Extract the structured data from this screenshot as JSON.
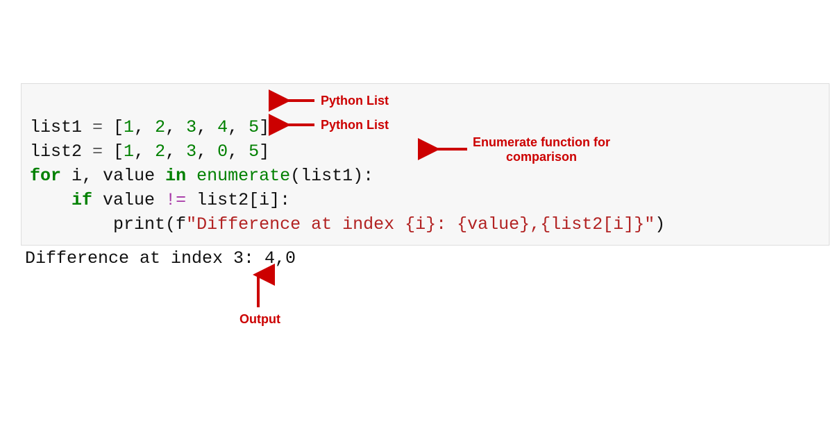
{
  "code": {
    "line1": {
      "var": "list1",
      "eq": " = ",
      "lb": "[",
      "n1": "1",
      "c1": ", ",
      "n2": "2",
      "c2": ", ",
      "n3": "3",
      "c3": ", ",
      "n4": "4",
      "c4": ", ",
      "n5": "5",
      "rb": "]"
    },
    "line2": {
      "var": "list2",
      "eq": " = ",
      "lb": "[",
      "n1": "1",
      "c1": ", ",
      "n2": "2",
      "c2": ", ",
      "n3": "3",
      "c3": ", ",
      "n4": "0",
      "c4": ", ",
      "n5": "5",
      "rb": "]"
    },
    "line3": {
      "for": "for",
      "sp1": " ",
      "i": "i",
      "comma": ", ",
      "value": "value",
      "sp2": " ",
      "in": "in",
      "sp3": " ",
      "enum": "enumerate",
      "op": "(list1):"
    },
    "line4": {
      "indent": "    ",
      "if": "if",
      "sp": " ",
      "value": "value",
      "neq": " != ",
      "expr": "list2[i]:"
    },
    "line5": {
      "indent": "        ",
      "print": "print",
      "op1": "(f",
      "s1": "\"Difference at index ",
      "i1o": "{i}",
      "s2": ": ",
      "i2o": "{value}",
      "s3": ",",
      "i3o": "{list2[i]}",
      "s4": "\"",
      "op2": ")"
    }
  },
  "output": {
    "text": "Difference at index 3: 4,0"
  },
  "annotations": {
    "pythonList1": "Python List",
    "pythonList2": "Python List",
    "enumerate": "Enumerate function\nfor comparison",
    "output": "Output"
  },
  "colors": {
    "annotation": "#cc0000",
    "codeBg": "#f7f7f7",
    "keyword": "#008000",
    "string": "#b22222"
  }
}
